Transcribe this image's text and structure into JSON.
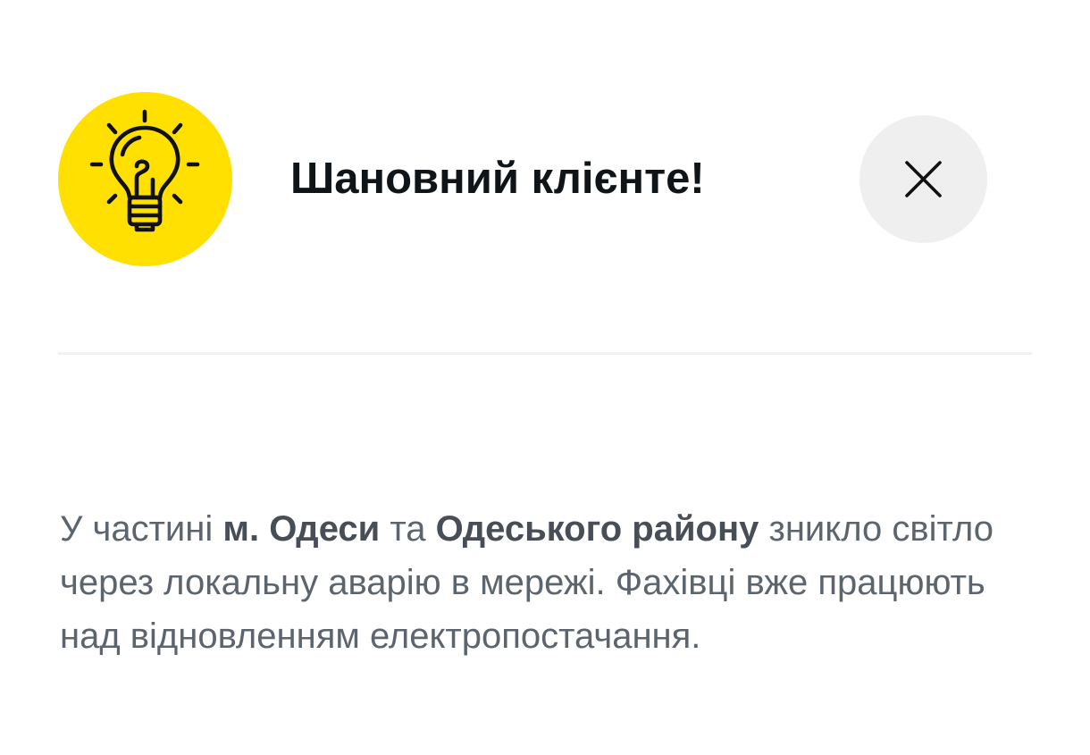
{
  "dialog": {
    "title": "Шановний клієнте!",
    "icon": "lightbulb-icon",
    "close_icon": "close-icon",
    "colors": {
      "badge": "#FFE000",
      "close_bg": "#EFEFEF",
      "title": "#0F1419",
      "text": "#5C646E"
    },
    "message": {
      "part1": "У частині ",
      "city": "м. Одеси",
      "part2": " та ",
      "district": "Одеського району",
      "part3": " зникло світло через локальну аварію в мережі. Фахівці вже працюють над відновленням електропостачання."
    }
  }
}
